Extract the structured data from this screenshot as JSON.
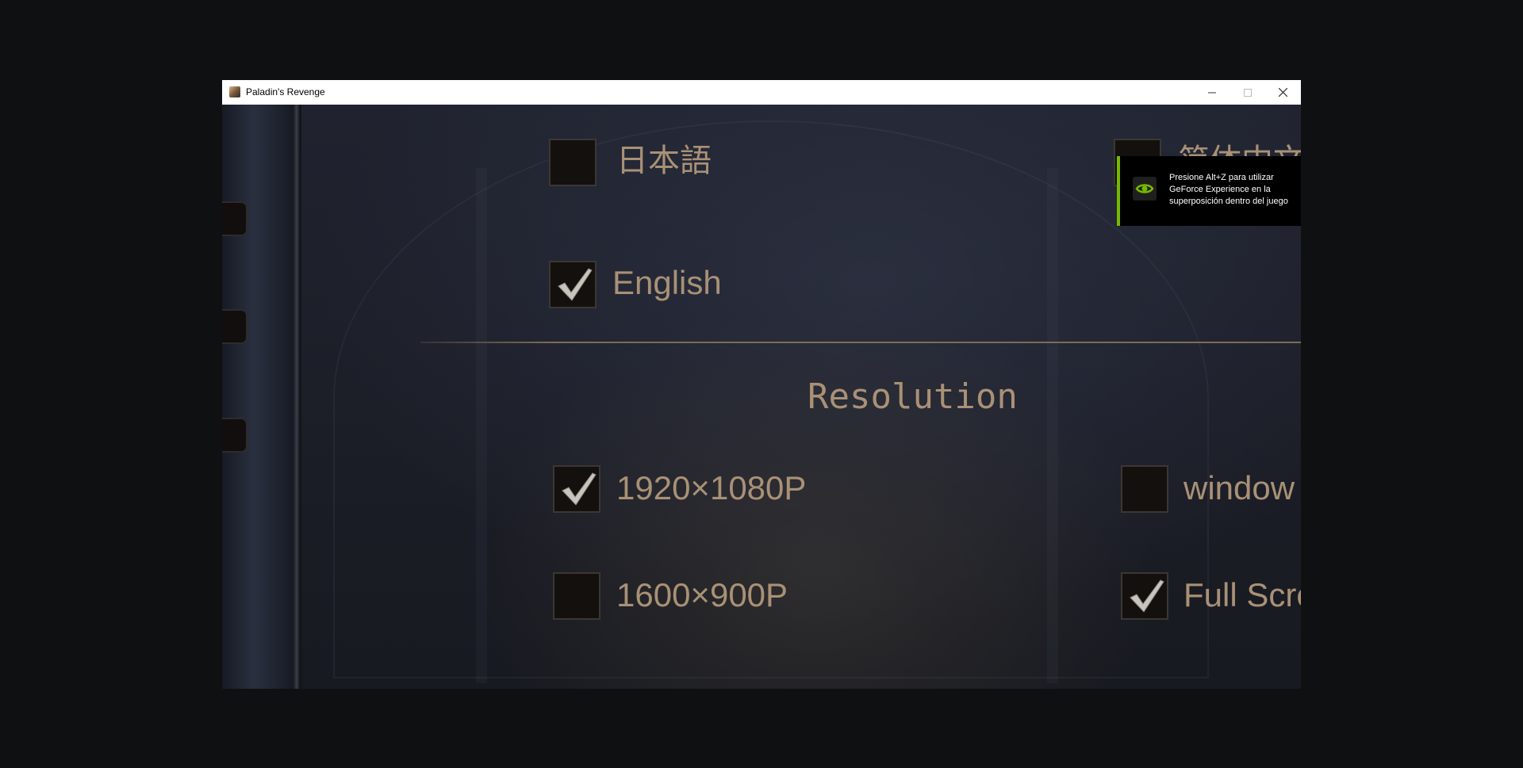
{
  "window": {
    "title": "Paladin's Revenge"
  },
  "language_options": [
    {
      "label": "日本語",
      "checked": false
    },
    {
      "label": "English",
      "checked": true
    },
    {
      "label": "简体中文",
      "checked": false
    }
  ],
  "resolution": {
    "title": "Resolution",
    "options": [
      {
        "label": "1920×1080P",
        "checked": true
      },
      {
        "label": "1600×900P",
        "checked": false
      },
      {
        "label": "window",
        "checked": false
      },
      {
        "label": "Full Screen",
        "checked": true
      }
    ]
  },
  "nvidia_toast": {
    "message": "Presione Alt+Z para utilizar GeForce Experience en la superposición dentro del juego",
    "accent_color": "#76b900",
    "icon": "nvidia-eye-icon"
  },
  "colors": {
    "label_text": "#a99176",
    "checkbox_bg": "#14100e",
    "titlebar_bg": "#ffffff"
  }
}
